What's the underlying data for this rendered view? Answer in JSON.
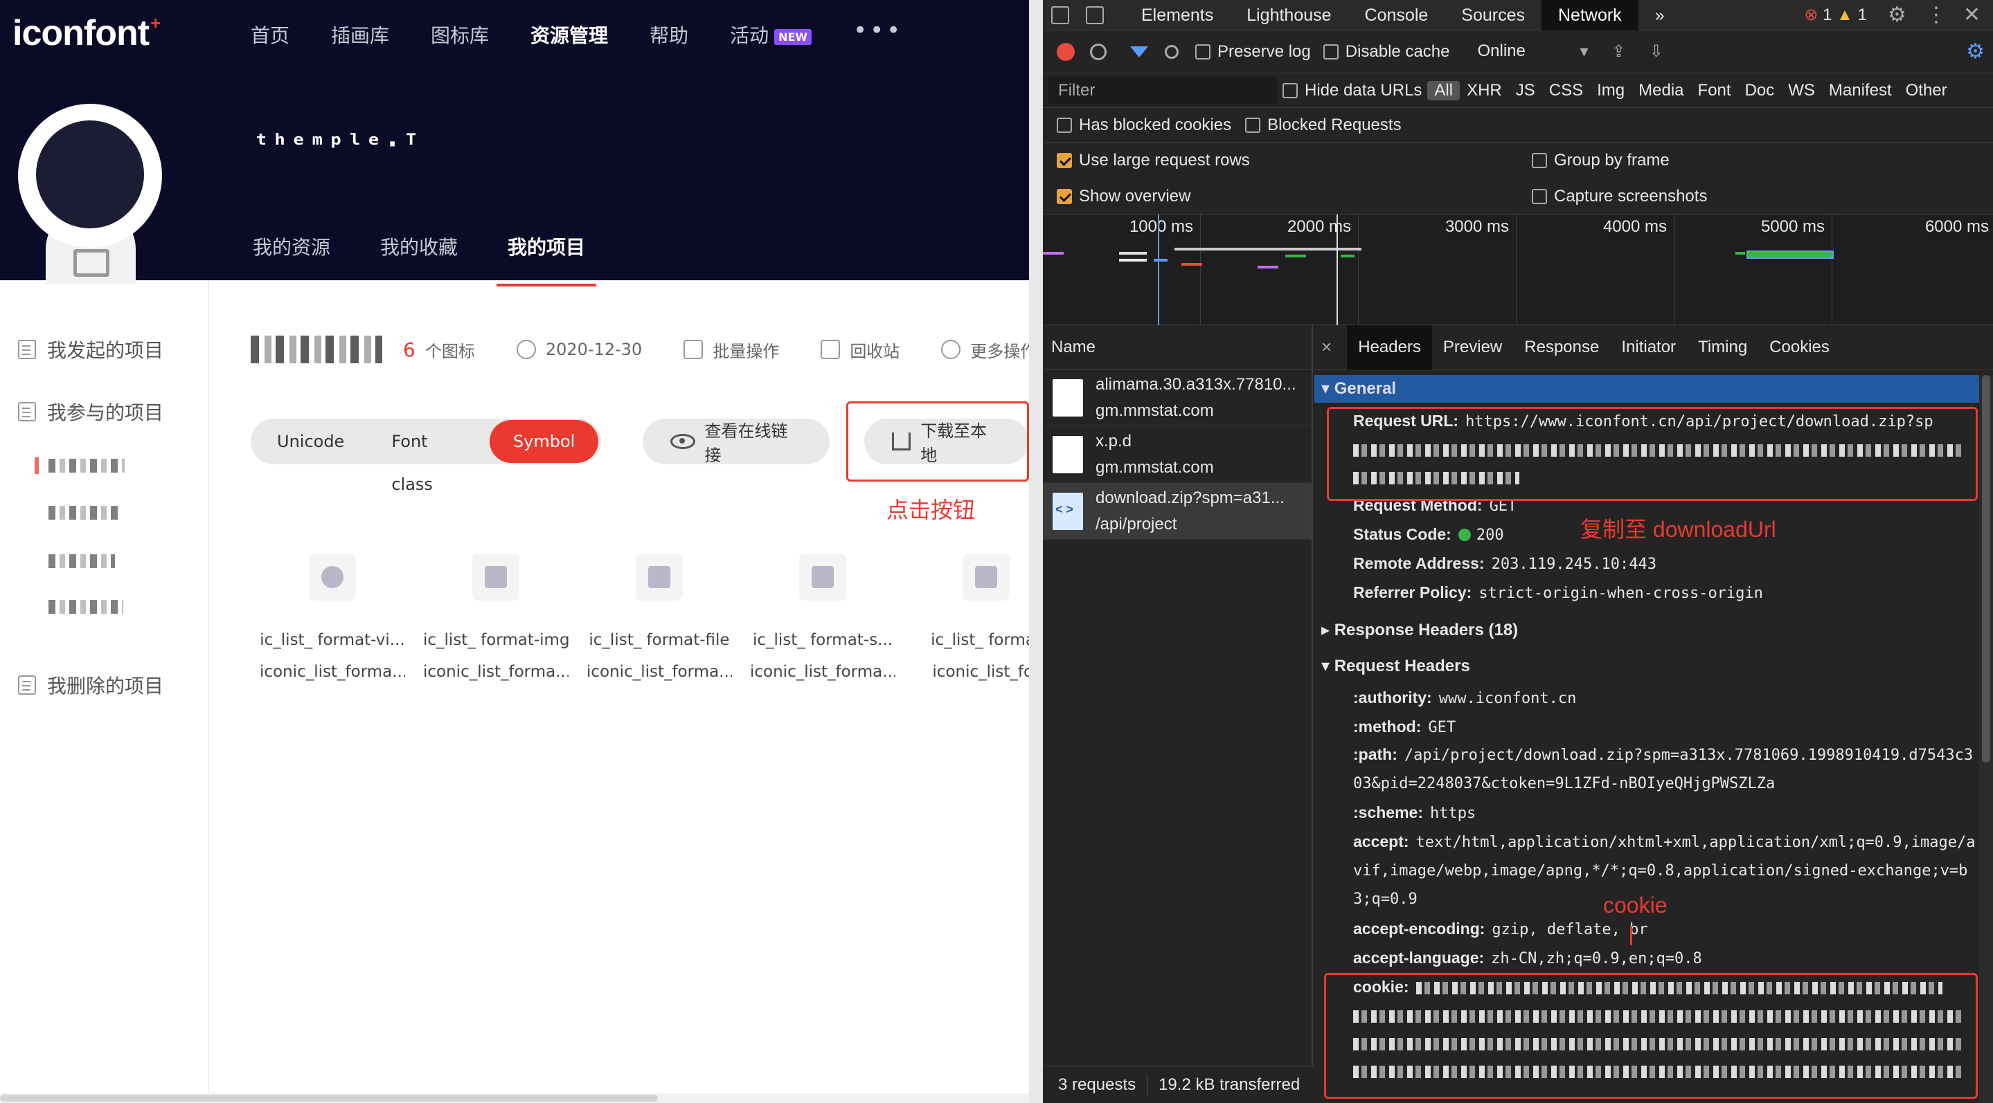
{
  "site": {
    "logo": "iconfont",
    "logo_plus": "+",
    "nav": [
      {
        "label": "首页"
      },
      {
        "label": "插画库"
      },
      {
        "label": "图标库"
      },
      {
        "label": "资源管理",
        "active": true
      },
      {
        "label": "帮助"
      },
      {
        "label": "活动",
        "badge": "NEW"
      }
    ],
    "nav_more": "•••",
    "username": "ᵗʰᵉᵐᵖˡᵉ·ᵀ",
    "subtabs": [
      "我的资源",
      "我的收藏",
      "我的项目"
    ],
    "sidebar": {
      "items": [
        "我发起的项目",
        "我参与的项目",
        "我删除的项目"
      ]
    },
    "project": {
      "count": "6",
      "count_unit": "个图标",
      "date": "2020-12-30",
      "batch": "批量操作",
      "recycle": "回收站",
      "more": "更多操作"
    },
    "modes": [
      "Unicode",
      "Font class",
      "Symbol"
    ],
    "view_online": "查看在线链接",
    "download": "下载至本地",
    "annotation_click": "点击按钮",
    "icons": [
      {
        "name": "ic_list_ format-vi...",
        "code": "iconic_list_forma..."
      },
      {
        "name": "ic_list_ format-img",
        "code": "iconic_list_forma..."
      },
      {
        "name": "ic_list_ format-file",
        "code": "iconic_list_forma..."
      },
      {
        "name": "ic_list_ format-s...",
        "code": "iconic_list_forma..."
      },
      {
        "name": "ic_list_ format",
        "code": "iconic_list_for"
      }
    ]
  },
  "devtools": {
    "tabs": [
      "Elements",
      "Lighthouse",
      "Console",
      "Sources",
      "Network"
    ],
    "active_tab": "Network",
    "more_tabs": "»",
    "errors": "1",
    "warnings": "1",
    "toolbar": {
      "preserve_log": "Preserve log",
      "disable_cache": "Disable cache",
      "throttle": "Online"
    },
    "filter": {
      "placeholder": "Filter",
      "hide_data_urls": "Hide data URLs",
      "types": [
        "All",
        "XHR",
        "JS",
        "CSS",
        "Img",
        "Media",
        "Font",
        "Doc",
        "WS",
        "Manifest",
        "Other"
      ]
    },
    "blocked": {
      "cookies": "Has blocked cookies",
      "requests": "Blocked Requests"
    },
    "settings": {
      "large_rows": "Use large request rows",
      "group_by_frame": "Group by frame",
      "show_overview": "Show overview",
      "capture_screenshots": "Capture screenshots"
    },
    "overview_ticks": [
      "1000 ms",
      "2000 ms",
      "3000 ms",
      "4000 ms",
      "5000 ms",
      "6000 ms"
    ],
    "requests": {
      "header": "Name",
      "items": [
        {
          "name": "alimama.30.a313x.77810...",
          "path": "gm.mmstat.com"
        },
        {
          "name": "x.p.d",
          "path": "gm.mmstat.com"
        },
        {
          "name": "download.zip?spm=a31...",
          "path": "/api/project"
        }
      ],
      "status_count": "3 requests",
      "status_size": "19.2 kB transferred"
    },
    "detail": {
      "tabs": [
        "Headers",
        "Preview",
        "Response",
        "Initiator",
        "Timing",
        "Cookies"
      ],
      "close": "×",
      "general": "General",
      "request_url_key": "Request URL:",
      "request_url": "https://www.iconfont.cn/api/project/download.zip?sp",
      "request_method_key": "Request Method:",
      "request_method": "GET",
      "status_code_key": "Status Code:",
      "status_code": "200",
      "remote_address_key": "Remote Address:",
      "remote_address": "203.119.245.10:443",
      "referrer_policy_key": "Referrer Policy:",
      "referrer_policy": "strict-origin-when-cross-origin",
      "response_headers": "Response Headers (18)",
      "request_headers": "Request Headers",
      "authority_key": ":authority:",
      "authority": "www.iconfont.cn",
      "method_key": ":method:",
      "method": "GET",
      "path_key": ":path:",
      "path": "/api/project/download.zip?spm=a313x.7781069.1998910419.d7543c303&pid=2248037&ctoken=9L1ZFd-nBOIyeQHjgPWSZLZa",
      "scheme_key": ":scheme:",
      "scheme": "https",
      "accept_key": "accept:",
      "accept": "text/html,application/xhtml+xml,application/xml;q=0.9,image/avif,image/webp,image/apng,*/*;q=0.8,application/signed-exchange;v=b3;q=0.9",
      "encoding_key": "accept-encoding:",
      "encoding": "gzip, deflate, br",
      "language_key": "accept-language:",
      "language": "zh-CN,zh;q=0.9,en;q=0.8",
      "cookie_key": "cookie:"
    },
    "annotation_copy": "复制至 downloadUrl",
    "annotation_cookie": "cookie"
  },
  "colors": {
    "brand_red": "#ea3a30",
    "header_bg": "#0b0b27",
    "devtools_bg": "#242424",
    "general_bar": "#235a9f"
  }
}
